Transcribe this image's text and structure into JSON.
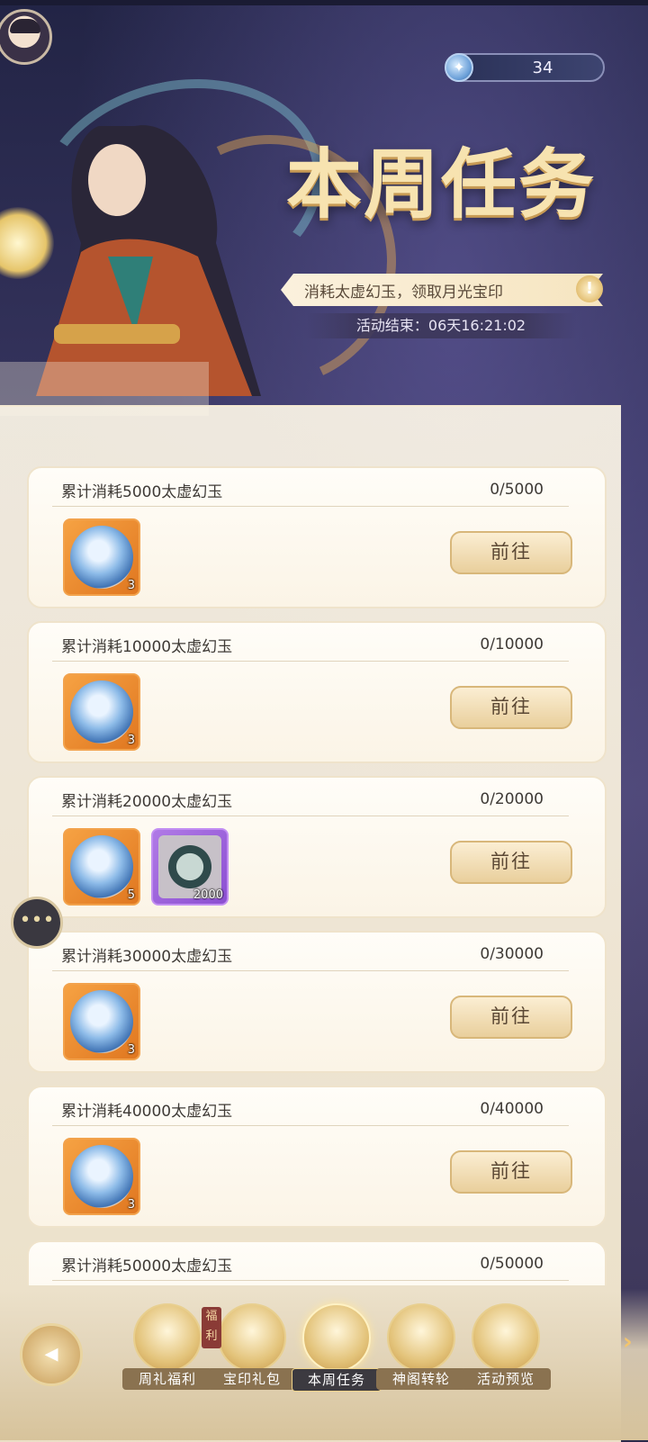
{
  "header": {
    "currency_value": "34",
    "title": "本周任务",
    "subtitle": "消耗太虚幻玉，领取月光宝印",
    "timer_label": "活动结束：",
    "timer_value": "06天16:21:02"
  },
  "tasks": [
    {
      "name": "累计消耗5000太虚幻玉",
      "progress": "0/5000",
      "button": "前往",
      "rewards": [
        {
          "type": "orange",
          "icon": "moonlight-seal-icon",
          "count": "3"
        }
      ]
    },
    {
      "name": "累计消耗10000太虚幻玉",
      "progress": "0/10000",
      "button": "前往",
      "rewards": [
        {
          "type": "orange",
          "icon": "moonlight-seal-icon",
          "count": "3"
        }
      ]
    },
    {
      "name": "累计消耗20000太虚幻玉",
      "progress": "0/20000",
      "button": "前往",
      "rewards": [
        {
          "type": "orange",
          "icon": "moonlight-seal-icon",
          "count": "5"
        },
        {
          "type": "purple",
          "icon": "jade-ring-icon",
          "count": "2000"
        }
      ]
    },
    {
      "name": "累计消耗30000太虚幻玉",
      "progress": "0/30000",
      "button": "前往",
      "rewards": [
        {
          "type": "orange",
          "icon": "moonlight-seal-icon",
          "count": "3"
        }
      ]
    },
    {
      "name": "累计消耗40000太虚幻玉",
      "progress": "0/40000",
      "button": "前往",
      "rewards": [
        {
          "type": "orange",
          "icon": "moonlight-seal-icon",
          "count": "3"
        }
      ]
    },
    {
      "name": "累计消耗50000太虚幻玉",
      "progress": "0/50000",
      "button": "前往",
      "rewards": []
    }
  ],
  "nav": {
    "items": [
      {
        "label": "周礼福利",
        "icon": "weekly-gift-icon",
        "active": false
      },
      {
        "label": "宝印礼包",
        "icon": "seal-pack-icon",
        "active": false,
        "badge": "福利"
      },
      {
        "label": "本周任务",
        "icon": "weekly-task-icon",
        "active": true
      },
      {
        "label": "神阁转轮",
        "icon": "wheel-icon",
        "active": false
      },
      {
        "label": "活动预览",
        "icon": "preview-icon",
        "active": false
      }
    ]
  }
}
